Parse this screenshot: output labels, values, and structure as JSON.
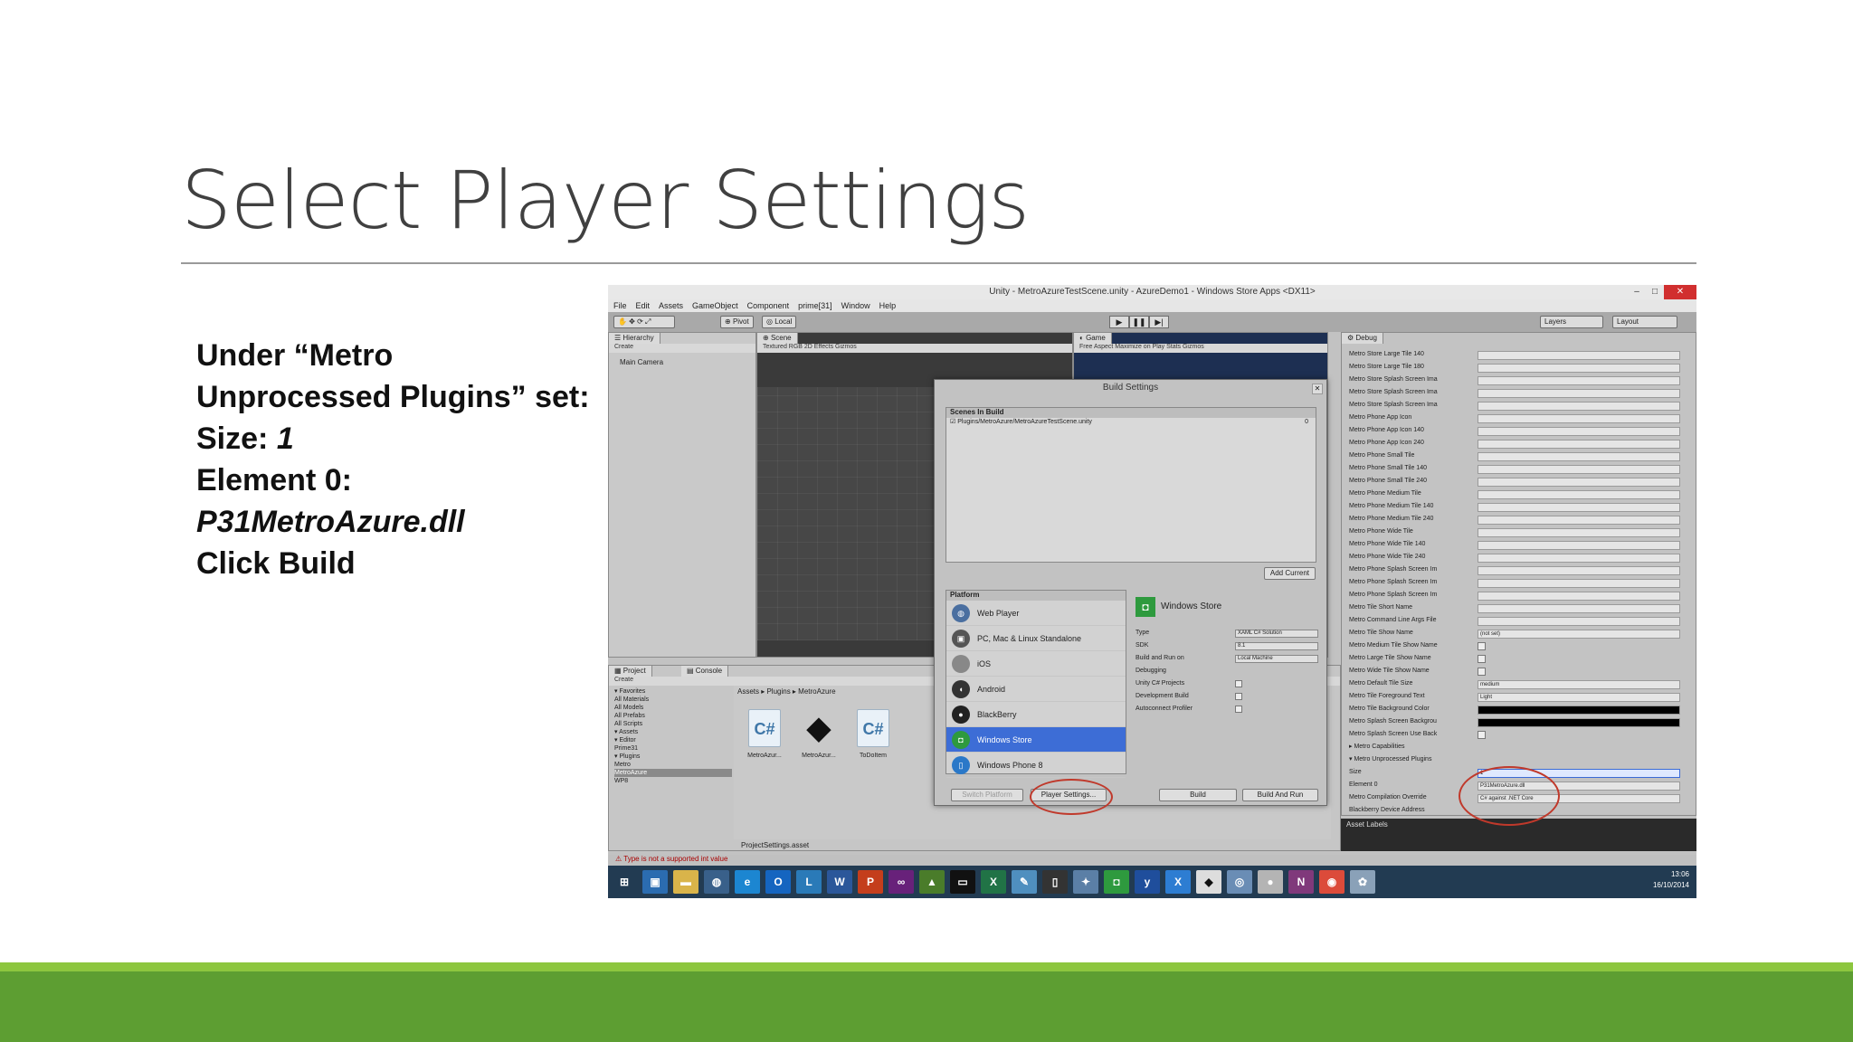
{
  "slide": {
    "title": "Select Player Settings",
    "instructions": {
      "line1": "Under “Metro",
      "line2": "Unprocessed Plugins” set:",
      "size_label": "Size: ",
      "size_value": "1",
      "element_label": "Element 0:",
      "element_value": "P31MetroAzure.dll",
      "click": "Click Build"
    },
    "colors": {
      "bar_light": "#8dc63f",
      "bar_dark": "#5d9e32"
    }
  },
  "unity": {
    "window_title": "Unity - MetroAzureTestScene.unity - AzureDemo1 - Windows Store Apps <DX11>",
    "menu": [
      "File",
      "Edit",
      "Assets",
      "GameObject",
      "Component",
      "prime[31]",
      "Window",
      "Help"
    ],
    "toolbar": {
      "pivot": "Pivot",
      "local": "Local",
      "layers": "Layers",
      "layout": "Layout"
    },
    "hierarchy": {
      "tab": "Hierarchy",
      "create": "Create",
      "item": "Main Camera"
    },
    "scene": {
      "tab": "Scene",
      "sub": "Textured   RGB   2D   Effects   Gizmos"
    },
    "game": {
      "tab": "Game",
      "sub": "Free Aspect      Maximize on Play  Stats  Gizmos"
    },
    "inspector": {
      "tab": "Debug",
      "rows": [
        {
          "label": "Metro Store Large Tile 140",
          "kind": "field",
          "value": ""
        },
        {
          "label": "Metro Store Large Tile 180",
          "kind": "field",
          "value": ""
        },
        {
          "label": "Metro Store Splash Screen Ima",
          "kind": "field",
          "value": ""
        },
        {
          "label": "Metro Store Splash Screen Ima",
          "kind": "field",
          "value": ""
        },
        {
          "label": "Metro Store Splash Screen Ima",
          "kind": "field",
          "value": ""
        },
        {
          "label": "Metro Phone App Icon",
          "kind": "field",
          "value": ""
        },
        {
          "label": "Metro Phone App Icon 140",
          "kind": "field",
          "value": ""
        },
        {
          "label": "Metro Phone App Icon 240",
          "kind": "field",
          "value": ""
        },
        {
          "label": "Metro Phone Small Tile",
          "kind": "field",
          "value": ""
        },
        {
          "label": "Metro Phone Small Tile 140",
          "kind": "field",
          "value": ""
        },
        {
          "label": "Metro Phone Small Tile 240",
          "kind": "field",
          "value": ""
        },
        {
          "label": "Metro Phone Medium Tile",
          "kind": "field",
          "value": ""
        },
        {
          "label": "Metro Phone Medium Tile 140",
          "kind": "field",
          "value": ""
        },
        {
          "label": "Metro Phone Medium Tile 240",
          "kind": "field",
          "value": ""
        },
        {
          "label": "Metro Phone Wide Tile",
          "kind": "field",
          "value": ""
        },
        {
          "label": "Metro Phone Wide Tile 140",
          "kind": "field",
          "value": ""
        },
        {
          "label": "Metro Phone Wide Tile 240",
          "kind": "field",
          "value": ""
        },
        {
          "label": "Metro Phone Splash Screen Im",
          "kind": "field",
          "value": ""
        },
        {
          "label": "Metro Phone Splash Screen Im",
          "kind": "field",
          "value": ""
        },
        {
          "label": "Metro Phone Splash Screen Im",
          "kind": "field",
          "value": ""
        },
        {
          "label": "Metro Tile Short Name",
          "kind": "field",
          "value": ""
        },
        {
          "label": "Metro Command Line Args File",
          "kind": "field",
          "value": ""
        },
        {
          "label": "Metro Tile Show Name",
          "kind": "field",
          "value": "(not set)"
        },
        {
          "label": "Metro Medium Tile Show Name",
          "kind": "check",
          "value": ""
        },
        {
          "label": "Metro Large Tile Show Name",
          "kind": "check",
          "value": ""
        },
        {
          "label": "Metro Wide Tile Show Name",
          "kind": "check",
          "value": ""
        },
        {
          "label": "Metro Default Tile Size",
          "kind": "field",
          "value": "medium"
        },
        {
          "label": "Metro Tile Foreground Text",
          "kind": "field",
          "value": "Light"
        },
        {
          "label": "Metro Tile Background Color",
          "kind": "black",
          "value": ""
        },
        {
          "label": "Metro Splash Screen Backgrou",
          "kind": "black",
          "value": ""
        },
        {
          "label": "Metro Splash Screen Use Back",
          "kind": "check",
          "value": ""
        },
        {
          "label": "▸ Metro Capabilities",
          "kind": "none",
          "value": ""
        },
        {
          "label": "▾ Metro Unprocessed Plugins",
          "kind": "none",
          "value": ""
        },
        {
          "label": "   Size",
          "kind": "blue",
          "value": "1"
        },
        {
          "label": "   Element 0",
          "kind": "field",
          "value": "P31MetroAzure.dll"
        },
        {
          "label": "Metro Compilation Override",
          "kind": "field",
          "value": "C# against .NET Core"
        },
        {
          "label": "Blackberry Device Address",
          "kind": "none",
          "value": ""
        }
      ],
      "asset_labels": "Asset Labels"
    },
    "project": {
      "tab": "Project",
      "console_tab": "Console",
      "create": "Create",
      "tree": [
        "▾ Favorites",
        "   All Materials",
        "   All Models",
        "   All Prefabs",
        "   All Scripts",
        "",
        "▾ Assets",
        "  ▾ Editor",
        "      Prime31",
        "  ▾ Plugins",
        "      Metro",
        "      MetroAzure",
        "      WP8"
      ],
      "selected_index": 11,
      "path": "Assets ▸ Plugins ▸ MetroAzure",
      "assets": [
        {
          "name": "MetroAzur...",
          "icon": "C#"
        },
        {
          "name": "MetroAzur...",
          "icon": "unity-logo"
        },
        {
          "name": "ToDoItem",
          "icon": "C#"
        }
      ],
      "footer": "ProjectSettings.asset"
    },
    "status": "Type is not a supported int value",
    "dialog": {
      "title": "Build Settings",
      "scenes_header": "Scenes In Build",
      "scene": "Plugins/MetroAzure/MetroAzureTestScene.unity",
      "scene_index": "0",
      "add_current": "Add Current",
      "platform_header": "Platform",
      "platforms": [
        {
          "name": "Web Player",
          "icon": "globe"
        },
        {
          "name": "PC, Mac & Linux Standalone",
          "icon": "pc"
        },
        {
          "name": "iOS",
          "icon": "ios"
        },
        {
          "name": "Android",
          "icon": "android"
        },
        {
          "name": "BlackBerry",
          "icon": "bb"
        },
        {
          "name": "Windows Store",
          "icon": "store"
        },
        {
          "name": "Windows Phone 8",
          "icon": "phone"
        }
      ],
      "selected_platform": 5,
      "right_title": "Windows Store",
      "options": [
        {
          "label": "Type",
          "value": "XAML C# Solution",
          "kind": "select"
        },
        {
          "label": "SDK",
          "value": "8.1",
          "kind": "select"
        },
        {
          "label": "Build and Run on",
          "value": "Local Machine",
          "kind": "select"
        },
        {
          "label": "Debugging",
          "value": "",
          "kind": "none"
        },
        {
          "label": "Unity C# Projects",
          "value": "",
          "kind": "check"
        },
        {
          "label": "Development Build",
          "value": "",
          "kind": "check"
        },
        {
          "label": "Autoconnect Profiler",
          "value": "",
          "kind": "check"
        }
      ],
      "switch_platform": "Switch Platform",
      "player_settings": "Player Settings...",
      "build": "Build",
      "build_and_run": "Build And Run"
    },
    "taskbar": {
      "time": "13:06",
      "date": "16/10/2014"
    }
  }
}
